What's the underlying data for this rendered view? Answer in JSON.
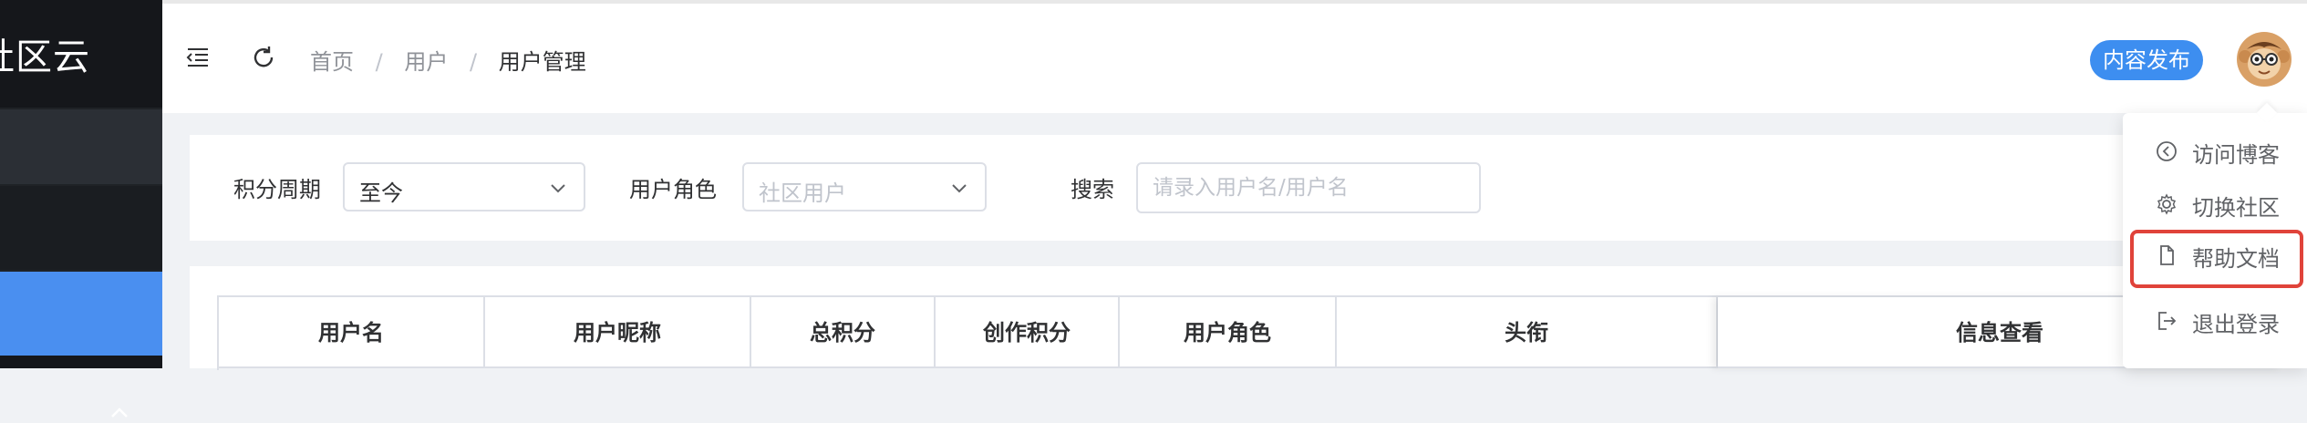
{
  "brand": {
    "title": "社区云"
  },
  "header": {
    "breadcrumb": [
      "首页",
      "用户",
      "用户管理"
    ],
    "separator": "/",
    "publish_button": "内容发布"
  },
  "filters": {
    "period_label": "积分周期",
    "period_value": "至今",
    "role_label": "用户角色",
    "role_placeholder": "社区用户",
    "search_label": "搜索",
    "search_placeholder": "请录入用户名/用户名"
  },
  "table": {
    "columns": [
      "用户名",
      "用户昵称",
      "总积分",
      "创作积分",
      "用户角色",
      "头衔",
      "信息查看"
    ]
  },
  "user_menu": {
    "items": [
      {
        "label": "访问博客",
        "icon": "chevron-left-circle-icon"
      },
      {
        "label": "切换社区",
        "icon": "gear-icon"
      },
      {
        "label": "帮助文档",
        "icon": "document-icon"
      },
      {
        "label": "退出登录",
        "icon": "logout-icon"
      }
    ]
  },
  "colors": {
    "sidebar": "#1f2226",
    "sidebar_active": "#4a8ff0",
    "accent": "#3d8ef0",
    "highlight_border": "#e0433a"
  }
}
